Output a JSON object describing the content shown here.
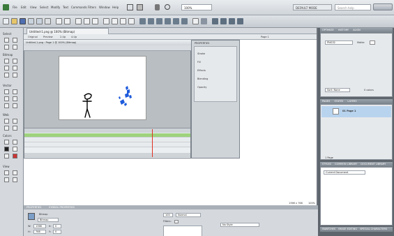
{
  "menu": {
    "items": [
      "File",
      "Edit",
      "View",
      "Select",
      "Modify",
      "Text",
      "Commands",
      "Filters",
      "Window",
      "Help"
    ],
    "zoom": "100%",
    "workspace": "DEFAULT MODE",
    "search_placeholder": "Search help"
  },
  "doc_tab": "Untitled-1.png @ 100% (Bitmap)",
  "edit_bar": {
    "original": "Original",
    "preview": "Preview",
    "two_up": "2-Up",
    "four_up": "4-Up"
  },
  "tools": {
    "sections": [
      "Select",
      "Bitmap",
      "Vector",
      "Web",
      "Colors",
      "View"
    ]
  },
  "stage": {
    "page_label": "Page 1",
    "floating_title": "Untitled-1.png : Page 1 @ 100% (Bitmap)",
    "colors": {
      "canvas": "#ffffff",
      "blue_strokes": "#1e5bdc",
      "stick": "#000000"
    }
  },
  "properties_float": {
    "title": "PROPERTIES",
    "rows": [
      "Stroke",
      "Fill",
      "Effects",
      "Blending",
      "Opacity"
    ]
  },
  "right_panels": {
    "optimize_tabs": [
      "OPTIMIZE",
      "HISTORY",
      "ALIGN"
    ],
    "format": "PNG32",
    "matte": "Matte:",
    "sort_label": "Sort: None",
    "colors_count": "0 colors",
    "pages_tabs": [
      "PAGES",
      "STATES",
      "LAYERS"
    ],
    "page_item": "01 Page 1",
    "pages_count": "1 Page",
    "styles_tabs": [
      "STYLES",
      "COMMON LIBRARY",
      "DOCUMENT LIBRARY"
    ],
    "current_document": "Current Document",
    "bottom_tabs": [
      "SWATCHES",
      "IMAGE EDITING",
      "SPECIAL CHARACTERS"
    ]
  },
  "bottom_properties": {
    "tabs": [
      "PROPERTIES",
      "SYMBOL PROPERTIES"
    ],
    "type": "Bitmap",
    "type_field": "Bitmap",
    "w_label": "W:",
    "w_value": "1366",
    "h_label": "H:",
    "h_value": "768",
    "x_label": "X:",
    "x_value": "0",
    "y_label": "Y:",
    "y_value": "0",
    "opacity": "100",
    "blend": "Normal",
    "filters": "Filters:",
    "no_style": "No Style",
    "doc_size": "1366 x 768",
    "zoom": "100%"
  }
}
